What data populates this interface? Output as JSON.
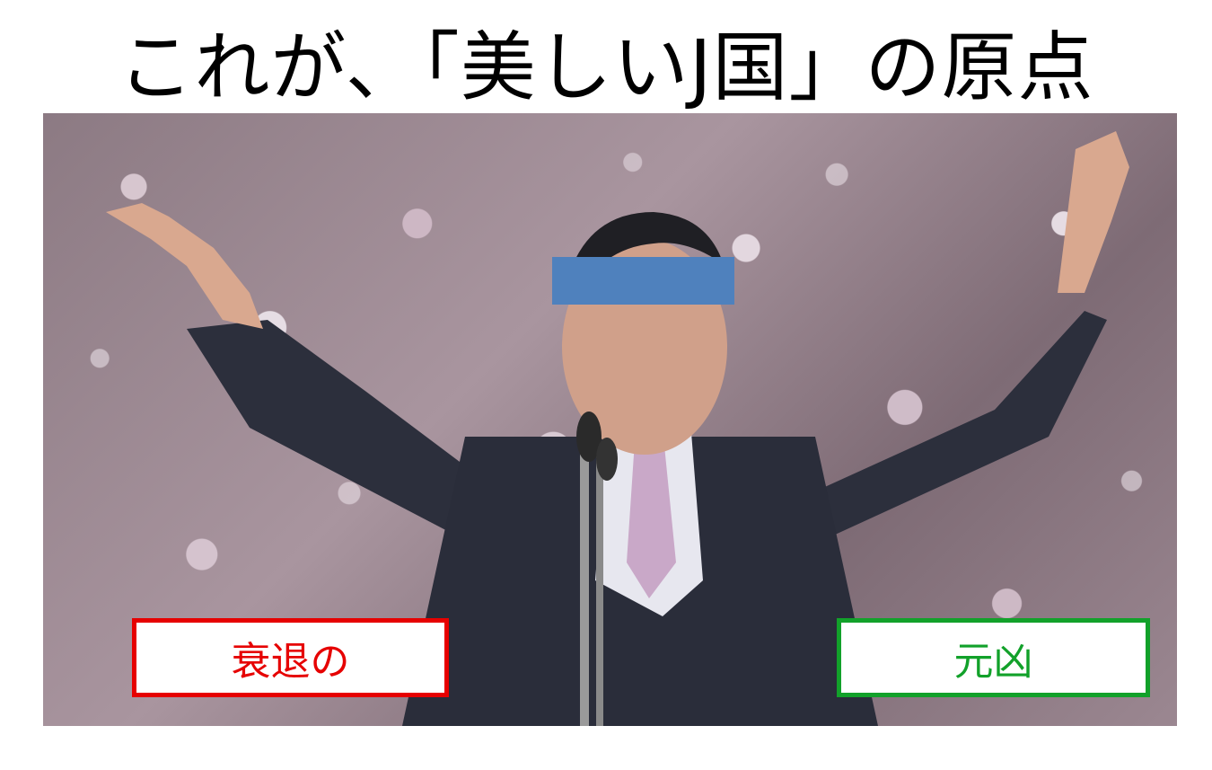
{
  "title": "これが、「美しいJ国」の原点",
  "labels": {
    "left": "衰退の",
    "right": "元凶"
  },
  "colors": {
    "left_border": "#e60000",
    "right_border": "#12a12a",
    "eye_bar": "#4f81bd"
  },
  "image": {
    "description_icons": [
      "cherry-blossom-background",
      "raised-arms-figure",
      "microphone-icon",
      "censor-bar"
    ]
  }
}
